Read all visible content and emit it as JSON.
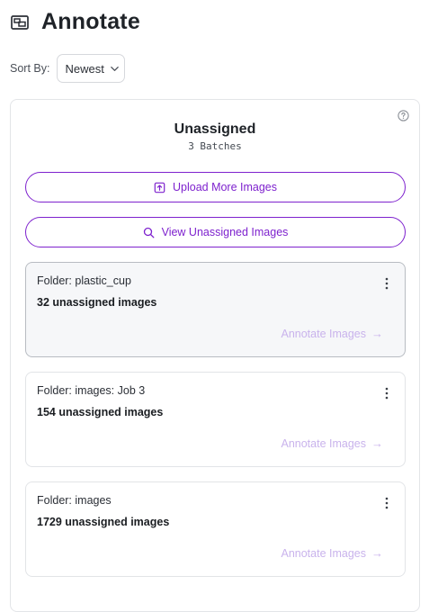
{
  "header": {
    "title": "Annotate",
    "icon": "annotate-icon"
  },
  "sort": {
    "label": "Sort By:",
    "value": "Newest"
  },
  "panel": {
    "title": "Unassigned",
    "subtitle": "3 Batches",
    "upload_label": "Upload More Images",
    "view_label": "View Unassigned Images"
  },
  "batches": [
    {
      "folder": "Folder: plastic_cup",
      "count": "32 unassigned images",
      "action": "Annotate Images"
    },
    {
      "folder": "Folder: images: Job 3",
      "count": "154 unassigned images",
      "action": "Annotate Images"
    },
    {
      "folder": "Folder: images",
      "count": "1729 unassigned images",
      "action": "Annotate Images"
    }
  ],
  "colors": {
    "accent": "#7e22ce",
    "link_muted": "#c9b3ec"
  }
}
